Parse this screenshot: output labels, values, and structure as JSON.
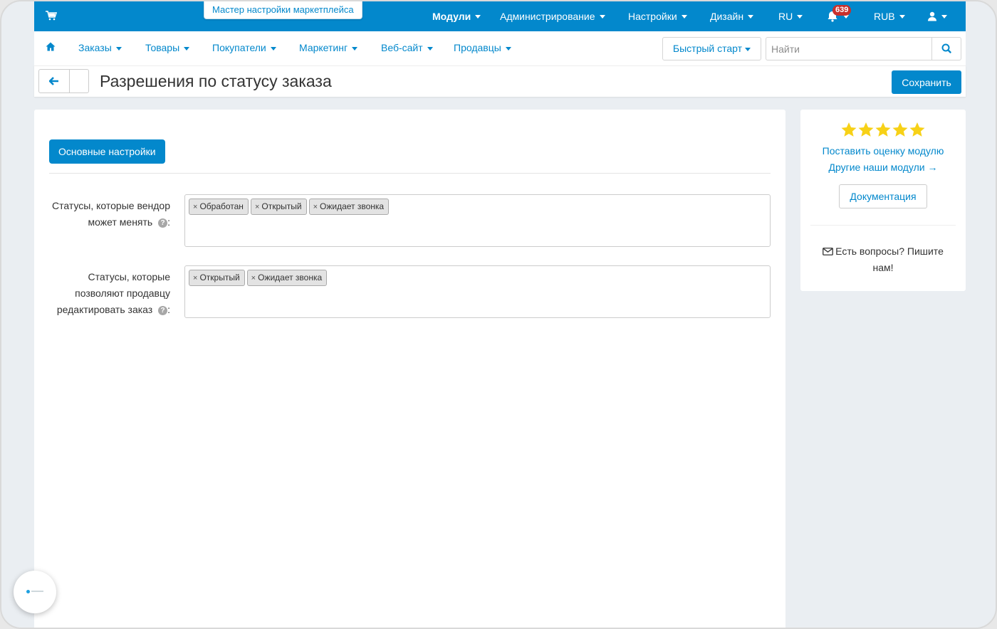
{
  "topbar": {
    "wizard_tab": "Мастер настройки маркетплейса",
    "menu": [
      {
        "label": "Модули"
      },
      {
        "label": "Администрирование"
      },
      {
        "label": "Настройки"
      },
      {
        "label": "Дизайн"
      },
      {
        "label": "RU"
      }
    ],
    "notification_count": "639",
    "currency": "RUB"
  },
  "subnav": {
    "items": [
      {
        "label": "Заказы"
      },
      {
        "label": "Товары"
      },
      {
        "label": "Покупатели"
      },
      {
        "label": "Маркетинг"
      },
      {
        "label": "Веб-сайт"
      },
      {
        "label": "Продавцы"
      }
    ],
    "quick_start": "Быстрый старт",
    "search_placeholder": "Найти"
  },
  "titlebar": {
    "title": "Разрешения по статусу заказа",
    "save_label": "Сохранить"
  },
  "main": {
    "tab_label": "Основные настройки",
    "fields": [
      {
        "label_line1": "Статусы, которые вендор",
        "label_line2": "может менять",
        "tags": [
          "Обработан",
          "Открытый",
          "Ожидает звонка"
        ]
      },
      {
        "label_line1": "Статусы, которые",
        "label_line2": "позволяют продавцу",
        "label_line3": "редактировать заказ",
        "tags": [
          "Открытый",
          "Ожидает звонка"
        ]
      }
    ],
    "tag_remove_glyph": "×",
    "label_suffix": ":"
  },
  "sidebar": {
    "rating_stars": 5,
    "rate_link": "Поставить оценку модулю",
    "other_modules_link": "Другие наши модули →",
    "docs_button": "Документация",
    "contact_line1": "Есть вопросы? Пишите",
    "contact_line2": "нам!"
  },
  "colors": {
    "primary": "#0388cc",
    "star": "#f7d117",
    "badge": "#c9302c"
  }
}
